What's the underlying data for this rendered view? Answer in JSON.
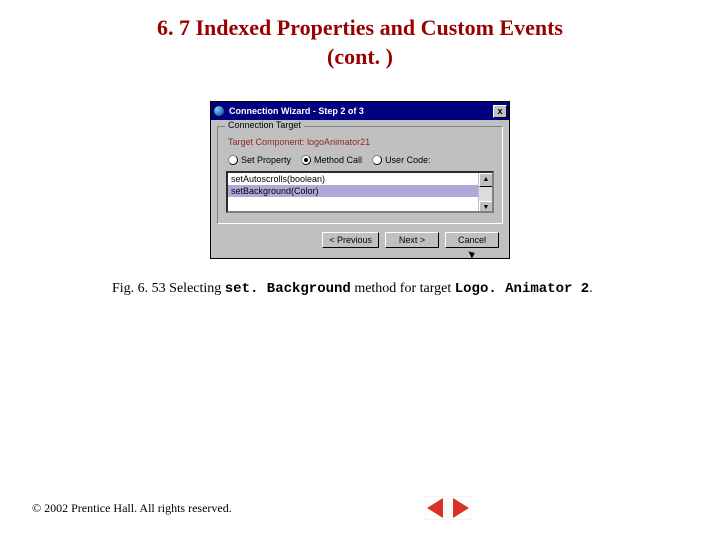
{
  "title_line1": "6. 7   Indexed Properties and Custom Events",
  "title_line2": "(cont. )",
  "wizard": {
    "titlebar": "Connection Wizard - Step 2 of 3",
    "close": "x",
    "group_legend": "Connection Target",
    "target_label": "Target Component: logoAnimator21",
    "radio_set_property": "Set Property",
    "radio_method_call": "Method Call",
    "radio_user_code": "User Code:",
    "list_item_0": "setAutoscrolls(boolean)",
    "list_item_1": "setBackground(Color)",
    "btn_prev": "< Previous",
    "btn_next": "Next >",
    "btn_cancel": "Cancel",
    "scroll_up": "▲",
    "scroll_down": "▼"
  },
  "caption": {
    "prefix": "Fig. 6. 53   Selecting ",
    "code1": "set. Background",
    "mid": " method for target ",
    "code2": "Logo. Animator 2",
    "suffix": "."
  },
  "footer": "© 2002 Prentice Hall. All rights reserved."
}
